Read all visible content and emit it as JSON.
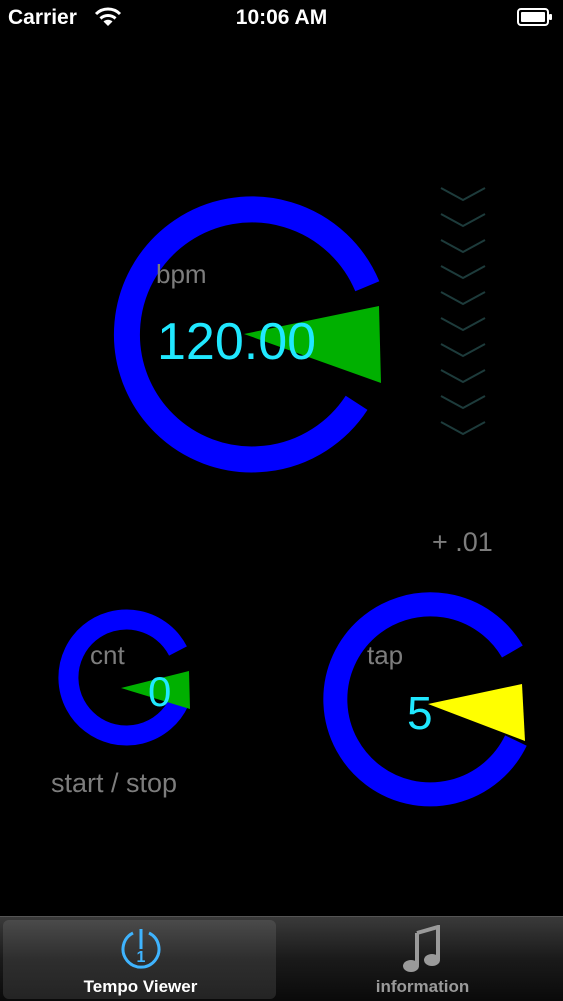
{
  "status_bar": {
    "carrier": "Carrier",
    "time": "10:06 AM"
  },
  "bpm_dial": {
    "label": "bpm",
    "value": "120.00",
    "ring_color": "#0000ff",
    "indicator_color": "#00b000"
  },
  "increment": {
    "label": "+ .01"
  },
  "count_dial": {
    "label": "cnt",
    "value": "0",
    "ring_color": "#0000ff",
    "indicator_color": "#00b000"
  },
  "start_stop": {
    "label": "start / stop"
  },
  "tap_dial": {
    "label": "tap",
    "value": "5",
    "ring_color": "#0000ff",
    "indicator_color": "#ffff00"
  },
  "value_color": "#20e8ff",
  "label_color": "#7d7d7d",
  "tabs": [
    {
      "label": "Tempo Viewer",
      "icon": "metronome-icon",
      "selected": true
    },
    {
      "label": "information",
      "icon": "music-note-icon",
      "selected": false
    }
  ]
}
